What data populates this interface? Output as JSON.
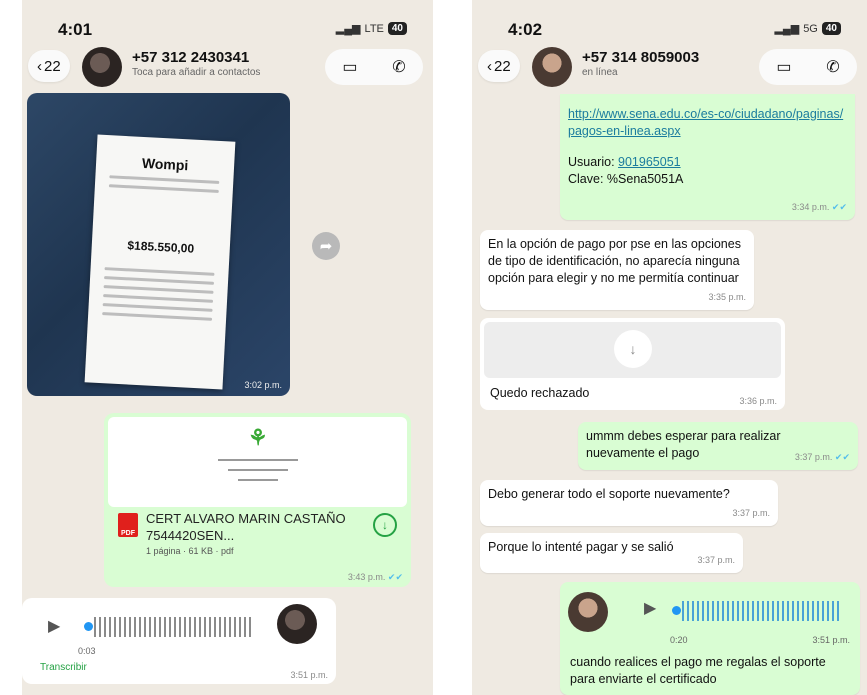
{
  "left": {
    "status": {
      "time": "4:01",
      "signal": "LTE",
      "battery": "40"
    },
    "header": {
      "back_count": "22",
      "contact_name": "+57 312 2430341",
      "contact_sub": "Toca para añadir a contactos"
    },
    "photo": {
      "brand": "Wompi",
      "amount": "$185.550,00",
      "time": "3:02 p.m."
    },
    "document": {
      "title": "CERT ALVARO MARIN CASTAÑO 7544420SEN...",
      "sub": "1 página · 61 KB · pdf",
      "time": "3:43 p.m."
    },
    "voice": {
      "duration": "0:03",
      "transcribe": "Transcribir",
      "time": "3:51 p.m."
    }
  },
  "right": {
    "status": {
      "time": "4:02",
      "signal": "5G",
      "battery": "40"
    },
    "header": {
      "back_count": "22",
      "contact_name": "+57 314 8059003",
      "contact_sub": "en línea"
    },
    "msg1": {
      "link": "http://www.sena.edu.co/es-co/ciudadano/paginas/pagos-en-linea.aspx",
      "user_label": "Usuario:",
      "user_value": "901965051",
      "pass_label": "Clave:",
      "pass_value": "%Sena5051A",
      "time": "3:34 p.m."
    },
    "msg2": {
      "text": "En la opción de pago por pse en las opciones de tipo de identificación, no aparecía ninguna opción para elegir y no me permitía continuar",
      "time": "3:35 p.m."
    },
    "msg3": {
      "text": "Quedo rechazado",
      "time": "3:36 p.m."
    },
    "msg4": {
      "text": "ummm debes esperar para realizar nuevamente el pago",
      "time": "3:37 p.m."
    },
    "msg5": {
      "text": "Debo generar todo el soporte nuevamente?",
      "time": "3:37 p.m."
    },
    "msg6": {
      "text": "Porque lo intenté pagar y se salió",
      "time": "3:37 p.m."
    },
    "voice": {
      "duration": "0:20",
      "time": "3:51 p.m."
    },
    "msg7": {
      "text": "cuando realices el pago me regalas el soporte para enviarte el certificado"
    }
  }
}
